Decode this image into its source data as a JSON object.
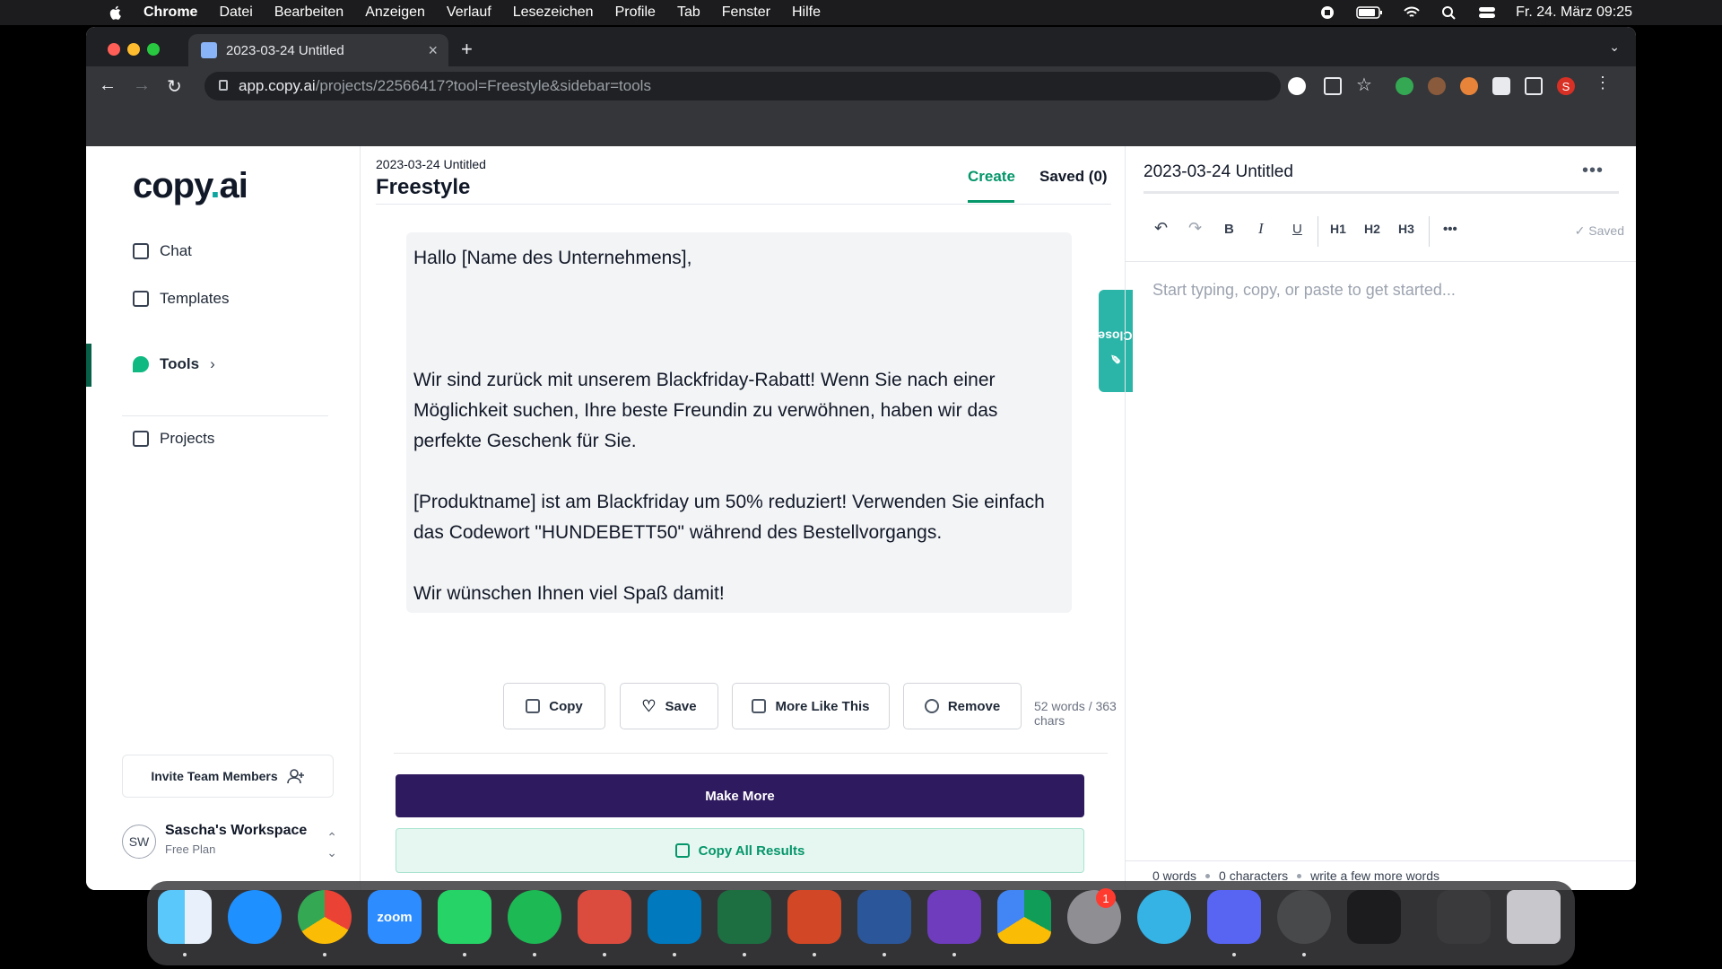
{
  "menubar": {
    "items": [
      "Chrome",
      "Datei",
      "Bearbeiten",
      "Anzeigen",
      "Verlauf",
      "Lesezeichen",
      "Profile",
      "Tab",
      "Fenster",
      "Hilfe"
    ],
    "clock": "Fr. 24. März  09:25"
  },
  "browser": {
    "tab_title": "2023-03-24 Untitled",
    "url_host": "app.copy.ai",
    "url_path": "/projects/22566417?tool=Freestyle&sidebar=tools",
    "profile_initial": "S"
  },
  "sidebar": {
    "logo_main": "copy",
    "logo_dot": ".",
    "logo_tail": "ai",
    "items": [
      {
        "label": "Chat",
        "icon": "chat-icon"
      },
      {
        "label": "Templates",
        "icon": "templates-icon"
      },
      {
        "label": "Tools",
        "icon": "tools-icon",
        "chevron": "›"
      },
      {
        "label": "Projects",
        "icon": "projects-icon"
      }
    ],
    "invite_label": "Invite Team Members",
    "workspace": {
      "initials": "SW",
      "name": "Sascha's Workspace",
      "plan": "Free Plan"
    }
  },
  "center": {
    "breadcrumb": "2023-03-24 Untitled",
    "title": "Freestyle",
    "tab_create": "Create",
    "tab_saved": "Saved (0)",
    "close_label": "Close",
    "result_paragraphs": [
      "Hallo [Name des Unternehmens],",
      "Wir sind zurück mit unserem Blackfriday-Rabatt! Wenn Sie nach einer Möglichkeit suchen, Ihre beste Freundin zu verwöhnen, haben wir das perfekte Geschenk für Sie.",
      "[Produktname] ist am Blackfriday um 50% reduziert! Verwenden Sie einfach das Codewort \"HUNDEBETT50\" während des Bestellvorgangs.",
      "Wir wünschen Ihnen viel Spaß damit!"
    ],
    "actions": {
      "copy": "Copy",
      "save": "Save",
      "more": "More Like This",
      "remove": "Remove"
    },
    "counts": "52 words / 363 chars",
    "make_more": "Make More",
    "copy_all": "Copy All Results"
  },
  "editor": {
    "title": "2023-03-24 Untitled",
    "menu": "•••",
    "tools": {
      "bold": "B",
      "italic": "I",
      "underline": "U",
      "h1": "H1",
      "h2": "H2",
      "h3": "H3",
      "more": "•••"
    },
    "saved": "Saved",
    "placeholder": "Start typing, copy, or paste to get started...",
    "status": {
      "words": "0 words",
      "chars": "0 characters",
      "hint": "write a few more words"
    }
  },
  "dock": {
    "apps": [
      "Finder",
      "Safari",
      "Chrome",
      "Zoom",
      "WhatsApp",
      "Spotify",
      "Todoist",
      "Trello",
      "Excel",
      "PowerPoint",
      "Word",
      "iMovie",
      "Google Drive",
      "System Settings",
      "Browser",
      "Discord",
      "QuickTime",
      "Voice Memos",
      "Screenshot",
      "Trash"
    ],
    "settings_badge": "1",
    "zoom_label": "zoom"
  }
}
